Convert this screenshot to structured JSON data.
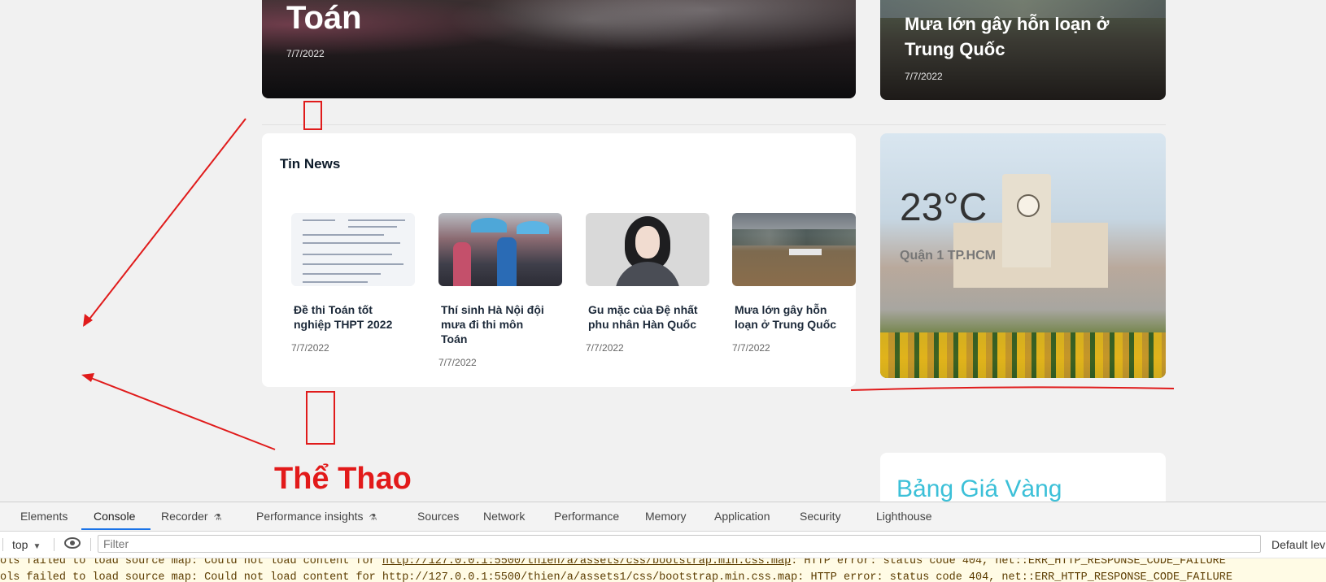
{
  "hero_main": {
    "title": "Toán",
    "date": "7/7/2022"
  },
  "hero_side": {
    "title": "Mưa lớn gây hỗn loạn ở Trung Quốc",
    "date": "7/7/2022"
  },
  "news": {
    "title": "Tin News",
    "items": [
      {
        "headline": "Đề thi Toán tốt nghiệp THPT 2022",
        "date": "7/7/2022"
      },
      {
        "headline": "Thí sinh Hà Nội đội mưa đi thi môn Toán",
        "date": "7/7/2022"
      },
      {
        "headline": "Gu mặc của Đệ nhất phu nhân Hàn Quốc",
        "date": "7/7/2022"
      },
      {
        "headline": "Mưa lớn gây hỗn loạn ở Trung Quốc",
        "date": "7/7/2022"
      }
    ]
  },
  "weather": {
    "temperature": "23°C",
    "city": "Quận 1 TP.HCM"
  },
  "sport": {
    "title": "Thể Thao"
  },
  "gold": {
    "title": "Bảng Giá Vàng"
  },
  "devtools": {
    "tabs": [
      "Elements",
      "Console",
      "Recorder",
      "Performance insights",
      "Sources",
      "Network",
      "Performance",
      "Memory",
      "Application",
      "Security",
      "Lighthouse"
    ],
    "active_tab": "Console",
    "context": "top",
    "filter_placeholder": "Filter",
    "levels_label": "Default lev",
    "messages": [
      {
        "prefix": "ols failed to load source map: Could not load content for ",
        "url": "http://127.0.0.1:5500/thien/a/assets/css/bootstrap.min.css.map",
        "suffix": ": HTTP error: status code 404, net::ERR_HTTP_RESPONSE_CODE_FAILURE"
      },
      {
        "prefix": "ols failed to load source map: Could not load content for ",
        "url": "http://127.0.0.1:5500/thien/a/assets1/css/bootstrap.min.css.map",
        "suffix": ": HTTP error: status code 404, net::ERR_HTTP_RESPONSE_CODE_FAILURE"
      }
    ]
  },
  "colors": {
    "annotation_red": "#e01b1b",
    "gold_title": "#3cc0d8",
    "devtools_tab_active": "#1a73e8"
  }
}
